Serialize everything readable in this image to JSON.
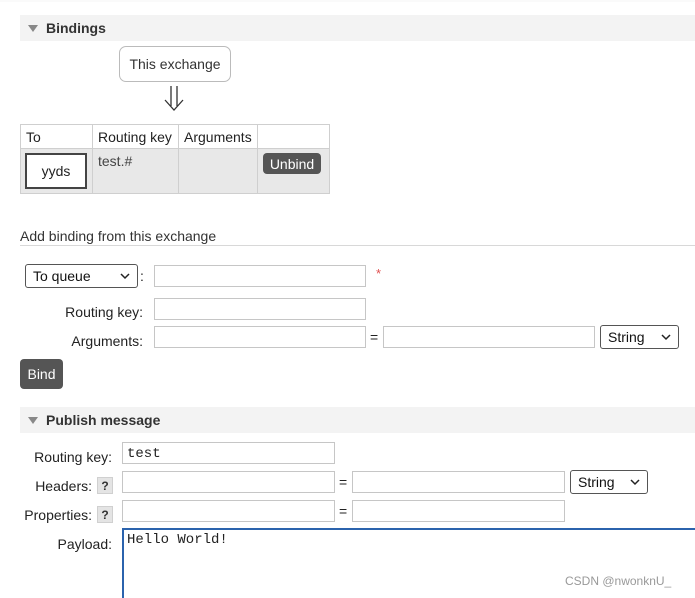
{
  "bindings": {
    "title": "Bindings",
    "this_exchange": "This exchange",
    "table": {
      "headers": [
        "To",
        "Routing key",
        "Arguments",
        ""
      ],
      "row": {
        "to": "yyds",
        "routing_key": "test.#",
        "arguments": "",
        "unbind_label": "Unbind"
      }
    }
  },
  "add_binding": {
    "title": "Add binding from this exchange",
    "destination_type": "To queue",
    "destination_value": "",
    "required_mark": "*",
    "routing_key_label": "Routing key:",
    "routing_key_value": "",
    "arguments_label": "Arguments:",
    "arg_key": "",
    "arg_value": "",
    "equals": "=",
    "arg_type": "String",
    "bind_label": "Bind"
  },
  "publish": {
    "title": "Publish message",
    "routing_key_label": "Routing key:",
    "routing_key_value": "test",
    "headers_label": "Headers:",
    "help": "?",
    "header_key": "",
    "header_value": "",
    "equals": "=",
    "header_type": "String",
    "properties_label": "Properties:",
    "prop_key": "",
    "prop_value": "",
    "payload_label": "Payload:",
    "payload_value": "Hello World!"
  },
  "watermark": "CSDN @nwonknU_"
}
